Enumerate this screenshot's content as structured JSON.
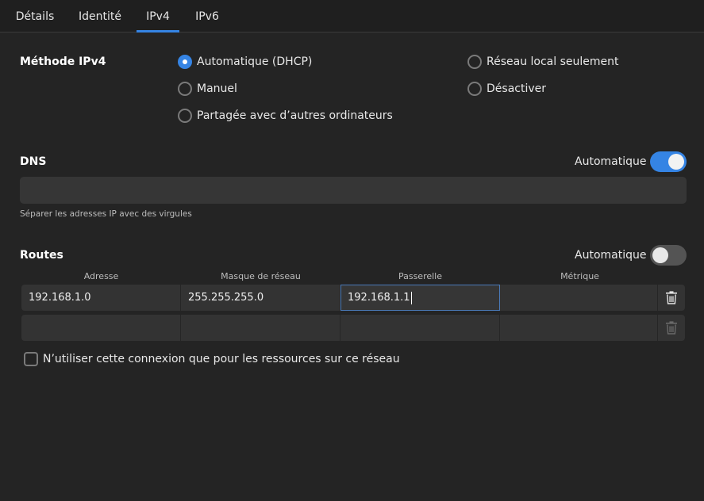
{
  "tabs": [
    {
      "label": "Détails",
      "active": false
    },
    {
      "label": "Identité",
      "active": false
    },
    {
      "label": "IPv4",
      "active": true
    },
    {
      "label": "IPv6",
      "active": false
    }
  ],
  "method": {
    "label": "Méthode IPv4",
    "options": [
      {
        "label": "Automatique (DHCP)",
        "checked": true
      },
      {
        "label": "Manuel",
        "checked": false
      },
      {
        "label": "Partagée avec d’autres ordinateurs",
        "checked": false
      },
      {
        "label": "Réseau local seulement",
        "checked": false
      },
      {
        "label": "Désactiver",
        "checked": false
      }
    ]
  },
  "dns": {
    "label": "DNS",
    "auto_label": "Automatique",
    "auto_on": true,
    "value": "",
    "hint": "Séparer les adresses IP avec des virgules"
  },
  "routes": {
    "label": "Routes",
    "auto_label": "Automatique",
    "auto_on": false,
    "columns": [
      "Adresse",
      "Masque de réseau",
      "Passerelle",
      "Métrique"
    ],
    "rows": [
      [
        "192.168.1.0",
        "255.255.255.0",
        "192.168.1.1",
        ""
      ],
      [
        "",
        "",
        "",
        ""
      ]
    ]
  },
  "restrict_checkbox": {
    "label": "N’utiliser cette connexion que pour les ressources sur ce réseau",
    "checked": false
  },
  "colors": {
    "accent": "#3584e4",
    "background": "#242424",
    "field": "#363636"
  },
  "icons": [
    "trash-icon",
    "radio-icon",
    "checkbox-icon",
    "switch-icon"
  ]
}
